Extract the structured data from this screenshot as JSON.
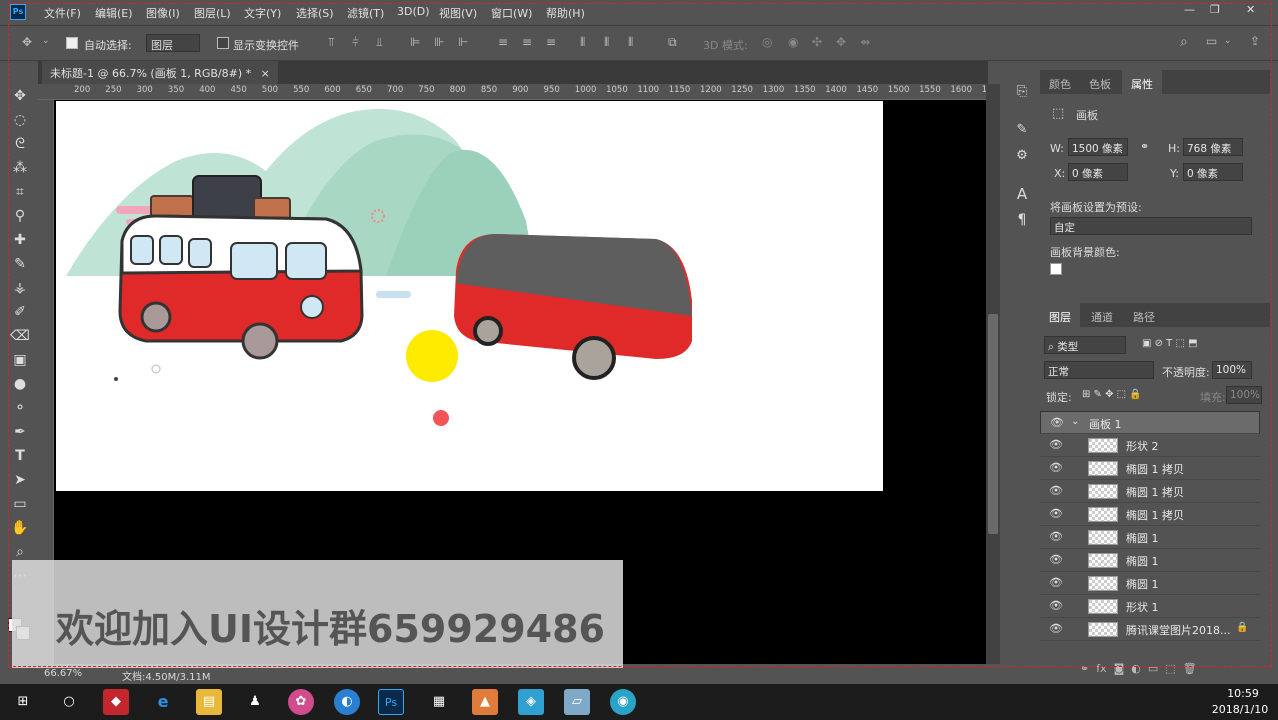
{
  "menubar": {
    "logo": "Ps",
    "items": [
      "文件(F)",
      "编辑(E)",
      "图像(I)",
      "图层(L)",
      "文字(Y)",
      "选择(S)",
      "滤镜(T)",
      "3D(D)",
      "视图(V)",
      "窗口(W)",
      "帮助(H)"
    ],
    "min": "—",
    "restore": "❐",
    "close": "✕"
  },
  "options": {
    "auto_select_label": "自动选择:",
    "auto_select_value": "图层",
    "show_transform_label": "显示变换控件",
    "mode3d_label": "3D 模式:"
  },
  "document": {
    "tab_title": "未标题-1 @ 66.7% (画板 1, RGB/8#) *",
    "tab_close": "×",
    "ruler_ticks": [
      "200",
      "250",
      "300",
      "350",
      "400",
      "450",
      "500",
      "550",
      "600",
      "650",
      "700",
      "750",
      "800",
      "850",
      "900",
      "950",
      "1000",
      "1050",
      "1100",
      "1150",
      "1200",
      "1250",
      "1300",
      "1350",
      "1400",
      "1450",
      "1500",
      "1550",
      "1600",
      "1"
    ],
    "zoom": "66.67%",
    "doc_size": "文档:4.50M/3.11M"
  },
  "properties": {
    "tabs": [
      "颜色",
      "色板",
      "属性"
    ],
    "title": "画板",
    "w_label": "W:",
    "w_value": "1500 像素",
    "h_label": "H:",
    "h_value": "768 像素",
    "x_label": "X:",
    "x_value": "0 像素",
    "y_label": "Y:",
    "y_value": "0 像素",
    "preset_label": "将画板设置为预设:",
    "preset_value": "自定",
    "bg_label": "画板背景颜色:"
  },
  "layers": {
    "tabs": [
      "图层",
      "通道",
      "路径"
    ],
    "filter_value": "类型",
    "blend_mode": "正常",
    "opacity_label": "不透明度:",
    "opacity_value": "100%",
    "lock_label": "锁定:",
    "fill_label": "填充:",
    "fill_value": "100%",
    "group_name": "画板 1",
    "rows": [
      "形状 2",
      "椭圆 1 拷贝",
      "椭圆 1 拷贝",
      "椭圆 1 拷贝",
      "椭圆 1",
      "椭圆 1",
      "椭圆 1",
      "形状 1",
      "腾讯课堂图片2018..."
    ]
  },
  "watermark": {
    "text": "欢迎加入UI设计群659929486"
  },
  "taskbar": {
    "time": "10:59",
    "date": "2018/1/10"
  },
  "colors": {
    "ps_blue": "#31a8ff",
    "bus_red": "#e02a2a",
    "bus_gray": "#5e5e5e",
    "mint": "#a8d8c4"
  }
}
